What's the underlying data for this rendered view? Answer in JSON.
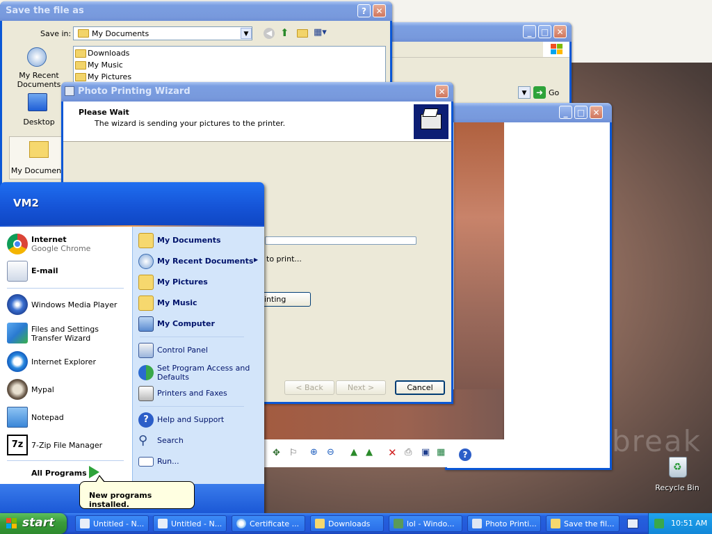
{
  "save_dialog": {
    "title": "Save the file as",
    "save_in_label": "Save in:",
    "save_in_value": "My Documents",
    "places": [
      "My Recent Documents",
      "Desktop",
      "My Documents"
    ],
    "files": [
      "Downloads",
      "My Music",
      "My Pictures"
    ]
  },
  "browser_window": {
    "go_label": "Go"
  },
  "wizard": {
    "title": "Photo Printing Wizard",
    "heading": "Please Wait",
    "subheading": "The wizard is sending your pictures to the printer.",
    "status_text": "to print...",
    "cancel_printing_fragment": "inting",
    "back_label": "< Back",
    "next_label": "Next >",
    "cancel_label": "Cancel",
    "progress": 0
  },
  "start_menu": {
    "user": "VM2",
    "pinned": [
      {
        "label": "Internet",
        "sub": "Google Chrome",
        "icon": "chrome-icon"
      },
      {
        "label": "E-mail",
        "icon": "email-icon"
      }
    ],
    "recent": [
      {
        "label": "Windows Media Player",
        "icon": "media-player-icon"
      },
      {
        "label": "Files and Settings Transfer Wizard",
        "icon": "transfer-wizard-icon"
      },
      {
        "label": "Internet Explorer",
        "icon": "ie-icon"
      },
      {
        "label": "Mypal",
        "icon": "mypal-icon"
      },
      {
        "label": "Notepad",
        "icon": "notepad-icon"
      },
      {
        "label": "7-Zip File Manager",
        "icon": "7zip-icon"
      }
    ],
    "all_programs": "All Programs",
    "right_items": [
      {
        "label": "My Documents",
        "bold": true,
        "icon": "folder-icon"
      },
      {
        "label": "My Recent Documents",
        "bold": true,
        "icon": "recent-docs-icon",
        "arrow": true
      },
      {
        "label": "My Pictures",
        "bold": true,
        "icon": "folder-icon"
      },
      {
        "label": "My Music",
        "bold": true,
        "icon": "folder-icon"
      },
      {
        "label": "My Computer",
        "bold": true,
        "icon": "computer-icon"
      },
      {
        "label": "Control Panel",
        "icon": "control-panel-icon"
      },
      {
        "label": "Set Program Access and Defaults",
        "icon": "program-access-icon"
      },
      {
        "label": "Printers and Faxes",
        "icon": "printer-icon"
      },
      {
        "label": "Help and Support",
        "icon": "help-icon"
      },
      {
        "label": "Search",
        "icon": "search-icon"
      },
      {
        "label": "Run...",
        "icon": "run-icon"
      }
    ]
  },
  "balloon": {
    "text": "New programs installed."
  },
  "desktop": {
    "recycle_bin": "Recycle Bin"
  },
  "taskbar": {
    "start": "start",
    "buttons": [
      "Untitled - N...",
      "Untitled - N...",
      "Certificate ...",
      "Downloads",
      "lol - Windo...",
      "Photo Printi...",
      "Save the fil..."
    ],
    "clock": "10:51 AM"
  },
  "colors": {
    "xp_blue": "#0a57d6",
    "start_green": "#3a9b3a",
    "menu_right_bg": "#d3e5fa"
  }
}
